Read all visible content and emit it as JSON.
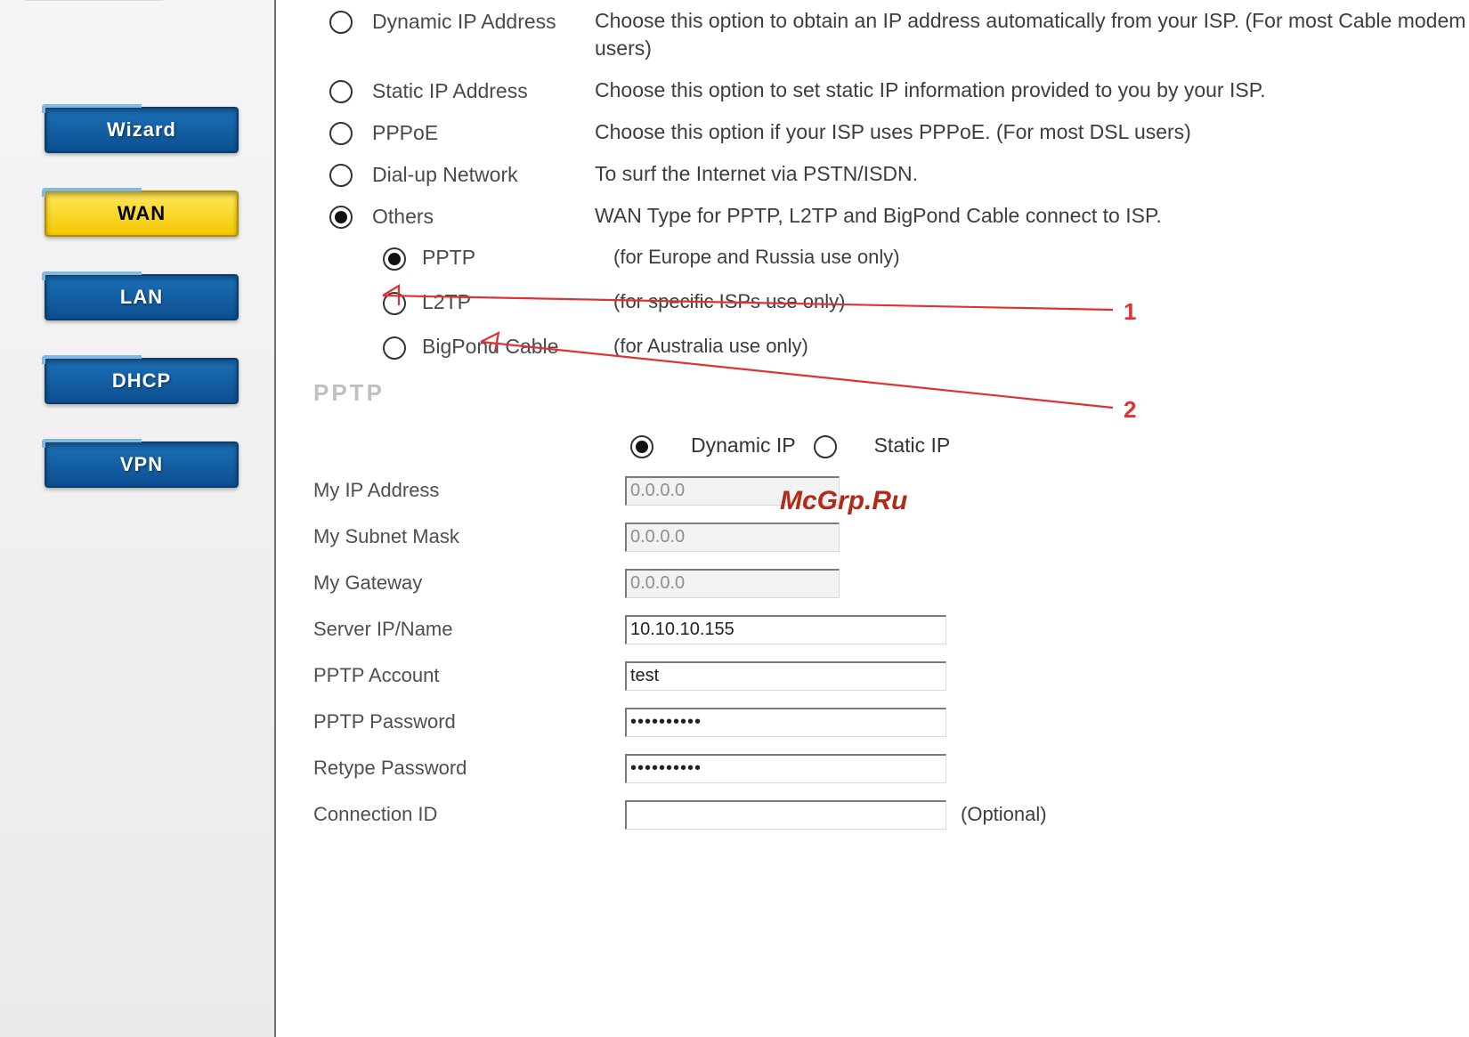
{
  "sidebar": {
    "items": [
      {
        "label": "Wizard"
      },
      {
        "label": "WAN"
      },
      {
        "label": "LAN"
      },
      {
        "label": "DHCP"
      },
      {
        "label": "VPN"
      }
    ],
    "active_index": 1
  },
  "wan_types": [
    {
      "label": "Dynamic IP Address",
      "desc": "Choose this option to obtain an IP address automatically from your ISP. (For most Cable modem users)"
    },
    {
      "label": "Static IP Address",
      "desc": "Choose this option to set static IP information provided to you by your ISP."
    },
    {
      "label": "PPPoE",
      "desc": "Choose this option if your ISP uses PPPoE. (For most DSL users)"
    },
    {
      "label": "Dial-up Network",
      "desc": "To surf the Internet via PSTN/ISDN."
    },
    {
      "label": "Others",
      "desc": "WAN Type for PPTP, L2TP and BigPond Cable connect to ISP."
    }
  ],
  "wan_types_selected": 4,
  "others_sub": [
    {
      "label": "PPTP",
      "desc": "(for Europe and Russia use only)"
    },
    {
      "label": "L2TP",
      "desc": "(for specific ISPs use only)"
    },
    {
      "label": "BigPond Cable",
      "desc": "(for Australia use only)"
    }
  ],
  "others_sub_selected": 0,
  "section_title": "PPTP",
  "watermark": "McGrp.Ru",
  "ip_mode": {
    "dynamic": "Dynamic IP",
    "static": "Static IP",
    "selected": "dynamic"
  },
  "fields": {
    "my_ip": {
      "label": "My IP Address",
      "value": "0.0.0.0"
    },
    "my_mask": {
      "label": "My Subnet Mask",
      "value": "0.0.0.0"
    },
    "my_gateway": {
      "label": "My Gateway",
      "value": "0.0.0.0"
    },
    "server": {
      "label": "Server IP/Name",
      "value": "10.10.10.155"
    },
    "account": {
      "label": "PPTP Account",
      "value": "test"
    },
    "password": {
      "label": "PPTP Password",
      "value": "••••••••••"
    },
    "repassword": {
      "label": "Retype Password",
      "value": "••••••••••"
    },
    "connid": {
      "label": "Connection ID",
      "value": "",
      "suffix": "(Optional)"
    }
  },
  "annotations": {
    "a1": "1",
    "a2": "2"
  }
}
